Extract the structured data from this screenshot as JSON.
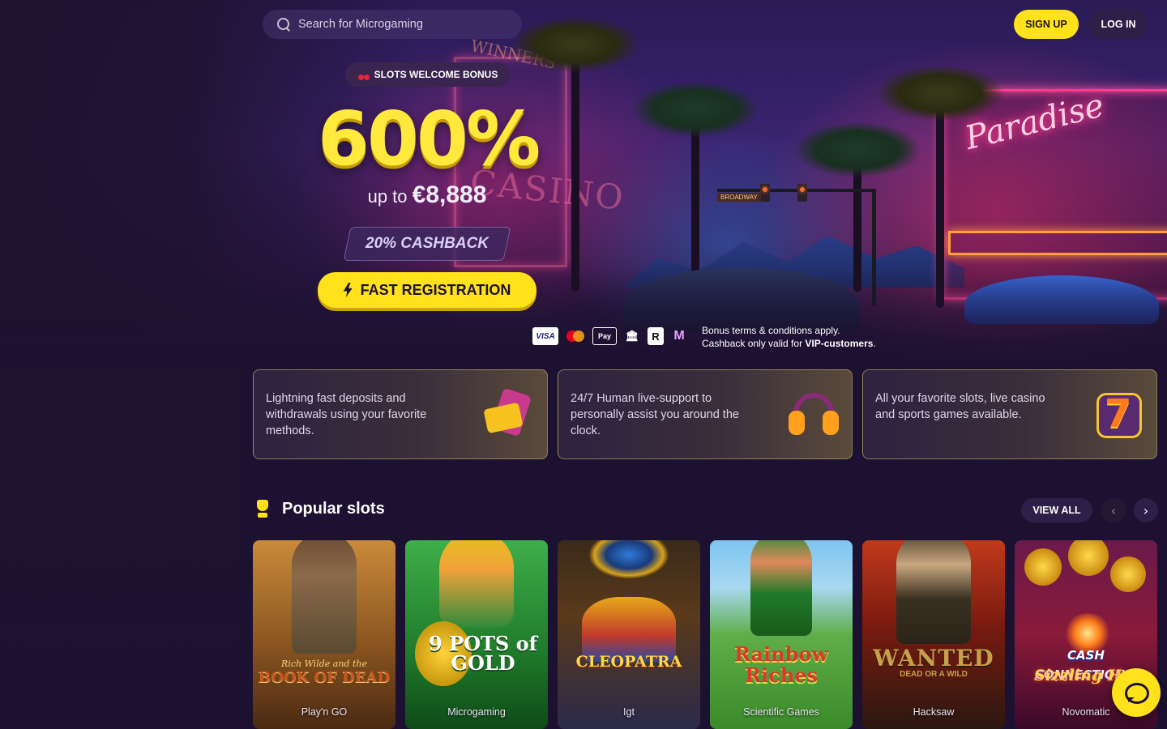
{
  "header": {
    "search_placeholder": "Search for Microgaming",
    "signup_label": "SIGN UP",
    "login_label": "LOG IN"
  },
  "hero": {
    "tag_label": "SLOTS WELCOME BONUS",
    "bonus_percent": "600%",
    "upto_prefix": "up to",
    "upto_amount": "€8,888",
    "cashback_label": "20% CASHBACK",
    "cta_label": "FAST REGISTRATION",
    "scene_signs": {
      "paradise": "Paradise",
      "casino": "CASINO",
      "winners": "WINNERS",
      "broadway": "BROADWAY"
    },
    "payment_methods": [
      "Visa",
      "Mastercard",
      "Apple Pay",
      "Bank transfer",
      "Revolut",
      "MiFinity"
    ],
    "payment_labels": {
      "visa": "VISA",
      "apple": "Pay",
      "bank": "🏛",
      "revolut": "R",
      "mifinity": "M"
    },
    "terms_line1": "Bonus terms & conditions apply.",
    "terms_line2_prefix": "Cashback only valid for",
    "terms_line2_bold": "VIP-customers",
    "terms_line2_suffix": "."
  },
  "features": [
    {
      "text": "Lightning fast deposits and withdrawals using your favorite methods.",
      "icon": "wallet-icon"
    },
    {
      "text": "24/7 Human live-support to personally assist you around the clock.",
      "icon": "headset-icon"
    },
    {
      "text": "All your favorite slots, live casino and sports games available.",
      "icon": "slot-seven-icon"
    }
  ],
  "popular": {
    "title": "Popular slots",
    "view_all_label": "VIEW ALL",
    "prev_label": "‹",
    "next_label": "›",
    "seven_glyph": "7",
    "slots": [
      {
        "title": "BOOK OF DEAD",
        "subtitle": "Rich Wilde and the",
        "provider": "Play'n GO"
      },
      {
        "title": "9 POTS of GOLD",
        "subtitle": "",
        "provider": "Microgaming"
      },
      {
        "title": "CLEOPATRA",
        "subtitle": "",
        "provider": "Igt"
      },
      {
        "title": "Rainbow Riches",
        "subtitle": "",
        "provider": "Scientific Games"
      },
      {
        "title": "WANTED",
        "subtitle": "DEAD OR A WILD",
        "provider": "Hacksaw"
      },
      {
        "title": "CASH CONNECTION™",
        "subtitle": "Sizzling H",
        "provider": "Novomatic"
      }
    ]
  },
  "colors": {
    "background": "#1d1131",
    "accent_yellow": "#ffe21a",
    "button_dark": "#2d1f47"
  }
}
